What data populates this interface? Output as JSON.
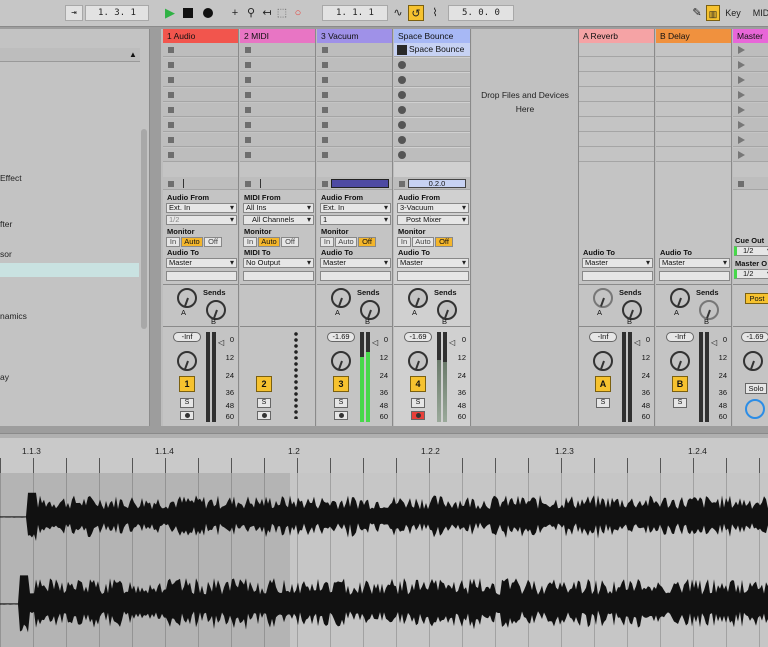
{
  "transport": {
    "arrangement_position": "1.  3.  1",
    "loop_start": "1.  1.  1",
    "loop_length": "5.  0.  0",
    "key_label": "Key",
    "midi_label": "MID"
  },
  "browser": {
    "items": [
      "Effect",
      "fter",
      "sor",
      "namics",
      "ay"
    ]
  },
  "tracks": [
    {
      "name": "1 Audio",
      "color": "#f2554d",
      "input_label": "Audio From",
      "input": "Ext. In",
      "channel": "1/2",
      "monitor_label": "Monitor",
      "monitor": [
        "In",
        "Auto",
        "Off"
      ],
      "monitor_active": "Auto",
      "output_label": "Audio To",
      "output": "Master",
      "sends_label": "Sends",
      "send_a": "A",
      "send_b": "B",
      "volume": "-Inf",
      "number": "1",
      "solo": "S"
    },
    {
      "name": "2 MIDI",
      "color": "#e875c4",
      "input_label": "MIDI From",
      "input": "All Ins",
      "channel": "All Channels",
      "monitor_label": "Monitor",
      "monitor": [
        "In",
        "Auto",
        "Off"
      ],
      "monitor_active": "Auto",
      "output_label": "MIDI To",
      "output": "No Output",
      "number": "2",
      "solo": "S"
    },
    {
      "name": "3 Vacuum",
      "color": "#9f91e8",
      "input_label": "Audio From",
      "input": "Ext. In",
      "channel": "1",
      "monitor_label": "Monitor",
      "monitor": [
        "In",
        "Auto",
        "Off"
      ],
      "monitor_active": "Off",
      "output_label": "Audio To",
      "output": "Master",
      "sends_label": "Sends",
      "send_a": "A",
      "send_b": "B",
      "volume": "-1.69",
      "number": "3",
      "solo": "S"
    },
    {
      "name": "Space Bounce",
      "color": "#a7b8f5",
      "clip": "Space Bounce",
      "progress": "0.2.0",
      "input_label": "Audio From",
      "input": "3-Vacuum",
      "channel": "Post Mixer",
      "monitor_label": "Monitor",
      "monitor": [
        "In",
        "Auto",
        "Off"
      ],
      "monitor_active": "Off",
      "output_label": "Audio To",
      "output": "Master",
      "sends_label": "Sends",
      "send_a": "A",
      "send_b": "B",
      "volume": "-1.69",
      "number": "4",
      "solo": "S"
    }
  ],
  "drop_zone": {
    "line1": "Drop Files and Devices",
    "line2": "Here"
  },
  "returns": [
    {
      "name": "A Reverb",
      "color": "#f5a3a5",
      "output_label": "Audio To",
      "output": "Master",
      "sends_label": "Sends",
      "send_a": "A",
      "send_b": "B",
      "volume": "-Inf",
      "letter": "A",
      "solo": "S"
    },
    {
      "name": "B Delay",
      "color": "#f0913e",
      "output_label": "Audio To",
      "output": "Master",
      "sends_label": "Sends",
      "send_a": "A",
      "send_b": "B",
      "volume": "-Inf",
      "letter": "B",
      "solo": "S"
    }
  ],
  "master": {
    "name": "Master",
    "color": "#e866d8",
    "cue_label": "Cue Out",
    "cue": "1/2",
    "master_out_label": "Master O",
    "master_out": "1/2",
    "post_label": "Post",
    "volume": "-1.69",
    "solo": "Solo"
  },
  "meter_scale": [
    "0",
    "12",
    "24",
    "36",
    "48",
    "60"
  ],
  "ruler": [
    "1.1.3",
    "1.1.4",
    "1.2",
    "1.2.2",
    "1.2.3",
    "1.2.4"
  ]
}
